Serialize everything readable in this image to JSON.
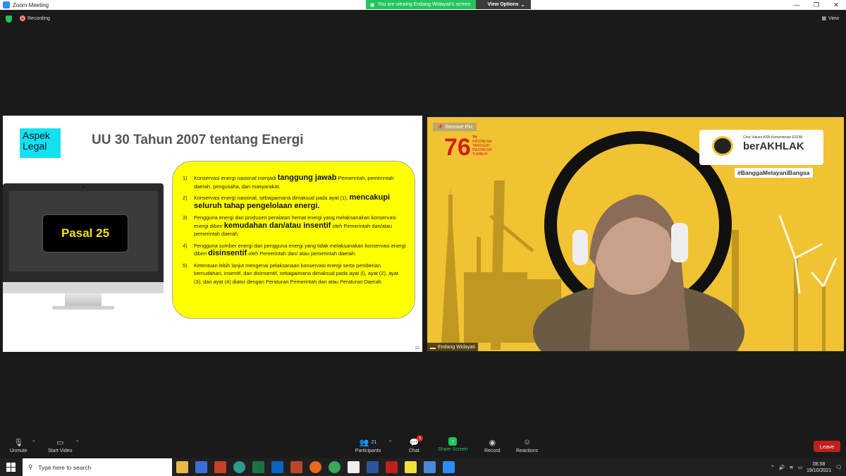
{
  "window": {
    "title": "Zoom Meeting",
    "minimize": "—",
    "maximize": "❐",
    "close": "✕"
  },
  "share_banner": {
    "viewing_text": "You are viewing Endang Widayati's screen",
    "view_options": "View Options",
    "caret": "⌄"
  },
  "status": {
    "recording": "Recording",
    "view": "View"
  },
  "slide": {
    "aspek": "Aspek Legal",
    "title": "UU 30 Tahun 2007 tentang Energi",
    "pasal": "Pasal 25",
    "page_number": "12",
    "items": [
      {
        "num": "1)",
        "pre": "Konservasi energi nasional menjadi ",
        "bold": "tanggung jawab",
        "post": " Pemerintah, pemerintah daerah, pengusaha, dan masyarakat."
      },
      {
        "num": "2)",
        "pre": "Konservasi energi nasional, sebagaimana dimaksud pada ayat (1), ",
        "bold": "mencakupi seluruh tahap pengelolaan energi.",
        "post": ""
      },
      {
        "num": "3)",
        "pre": "Pengguna energi dan produsen peralatan hemat energi yang melaksanakan konservasi energi diberi ",
        "bold": "kemudahan dan/atau insentif",
        "post": " oleh Pemerintah dan/atau pemerintah daerah."
      },
      {
        "num": "4)",
        "pre": "Pengguna sumber energi dan pengguna energi yang tidak melaksanakan konservasi energi diberi ",
        "bold": "disinsentif",
        "post": " oleh Pemerintah dan/ atau pemerintah daerah."
      },
      {
        "num": "5)",
        "pre": "Ketentuan lebih lanjut mengenai pelaksanaan konservasi energi serta pemberian kemudahan, insentif, dan disinsentif, sebagaimana dimaksud pada ayat (l), ayat (2), ayat (3), dan ayat (4) diatur dengan Peraturan Pemerintah dan atau Peraturan Daerah",
        "bold": "",
        "post": ""
      }
    ]
  },
  "video": {
    "remove_pin": "Remove Pin",
    "logo_76": "76",
    "logo_th": "TH",
    "logo_line1": "INDONESIA",
    "logo_line2": "TANGGUH",
    "logo_line3": "INDONESIA",
    "logo_line4": "TUMBUH",
    "core_values": "Core Values ASN Kementerian ESDM",
    "berakhlak": "berAKHLAK",
    "hashtag": "#BanggaMelayaniBangsa",
    "participant_name": "Endang Widayati"
  },
  "toolbar": {
    "unmute": "Unmute",
    "start_video": "Start Video",
    "participants": "Participants",
    "participants_count": "21",
    "chat": "Chat",
    "chat_badge": "5",
    "share_screen": "Share Screen",
    "record": "Record",
    "reactions": "Reactions",
    "leave": "Leave"
  },
  "taskbar": {
    "search_placeholder": "Type here to search",
    "time": "08.58",
    "date": "19/10/2021"
  }
}
